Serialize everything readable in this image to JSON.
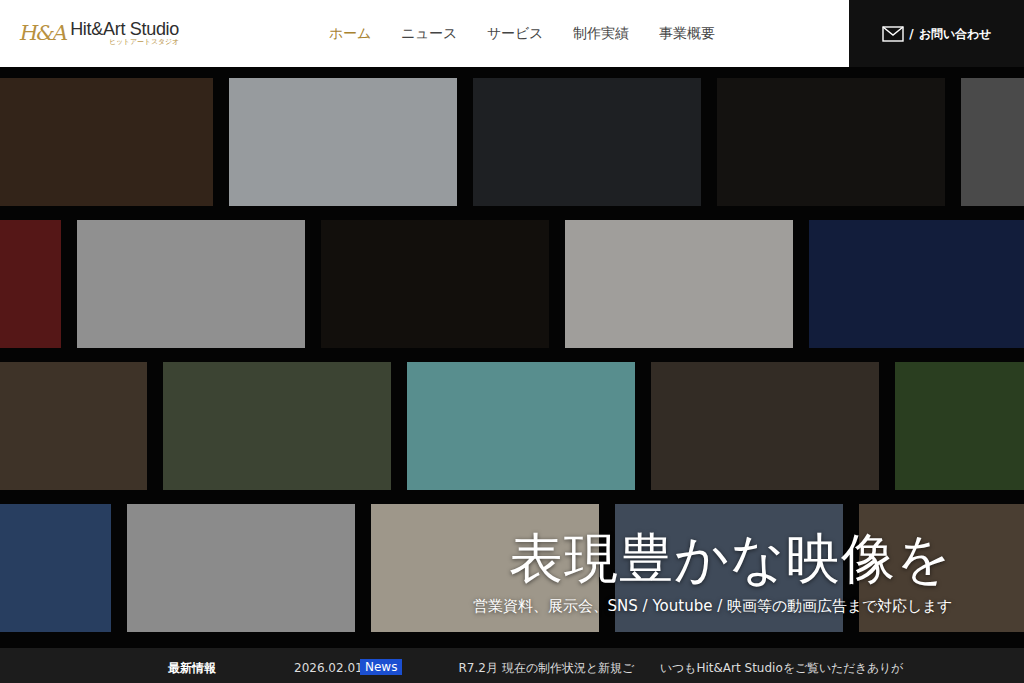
{
  "header": {
    "logo_mark": "H&A",
    "brand": "Hit&Art Studio",
    "brand_sub": "ヒットアートスタジオ"
  },
  "nav": [
    {
      "label": "ホーム",
      "selected": true
    },
    {
      "label": "ニュース",
      "selected": false
    },
    {
      "label": "サービス",
      "selected": false
    },
    {
      "label": "制作実績",
      "selected": false
    },
    {
      "label": "事業概要",
      "selected": false
    }
  ],
  "contact": {
    "separator": "/",
    "label": "お問い合わせ"
  },
  "hero": {
    "title": "表現豊かな映像を",
    "subtitle": "営業資料、展示会、SNS / Youtube / 映画等の動画広告まで対応します"
  },
  "news": {
    "heading": "最新情報",
    "items": [
      {
        "date": "2026.02.01",
        "tag": "News",
        "title": "R7.2月 現在の制作状況と新規ご"
      }
    ],
    "intro": "いつもHit&Art Studioをご覧いただきありが"
  }
}
